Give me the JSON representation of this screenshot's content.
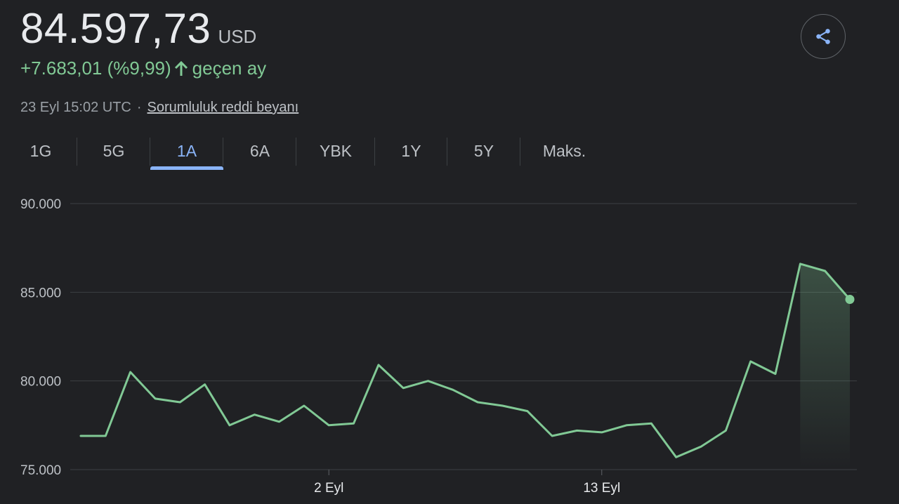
{
  "header": {
    "price": "84.597,73",
    "currency": "USD",
    "change": "+7.683,01 (%9,99)",
    "change_period": "geçen ay",
    "timestamp": "23 Eyl 15:02 UTC",
    "separator": "·",
    "disclaimer": "Sorumluluk reddi beyanı",
    "up_color": "#81c995"
  },
  "share": {
    "icon": "share-icon"
  },
  "tabs": [
    {
      "label": "1G",
      "active": false
    },
    {
      "label": "5G",
      "active": false
    },
    {
      "label": "1A",
      "active": true
    },
    {
      "label": "6A",
      "active": false
    },
    {
      "label": "YBK",
      "active": false
    },
    {
      "label": "1Y",
      "active": false
    },
    {
      "label": "5Y",
      "active": false
    },
    {
      "label": "Maks.",
      "active": false
    }
  ],
  "chart_data": {
    "type": "area",
    "title": "",
    "xlabel": "",
    "ylabel": "",
    "ylim": [
      75000,
      90000
    ],
    "y_ticks": [
      90000,
      85000,
      80000,
      75000
    ],
    "y_tick_labels": [
      "90.000",
      "85.000",
      "80.000",
      "75.000"
    ],
    "x_tick_labels": [
      {
        "label": "2 Eyl",
        "date": "2024-09-02"
      },
      {
        "label": "13 Eyl",
        "date": "2024-09-13"
      }
    ],
    "grid": true,
    "line_color": "#81c995",
    "series": [
      {
        "x": [
          "2024-08-23",
          "2024-08-24",
          "2024-08-25",
          "2024-08-26",
          "2024-08-27",
          "2024-08-28",
          "2024-08-29",
          "2024-08-30",
          "2024-08-31",
          "2024-09-01",
          "2024-09-02",
          "2024-09-03",
          "2024-09-04",
          "2024-09-05",
          "2024-09-06",
          "2024-09-07",
          "2024-09-08",
          "2024-09-09",
          "2024-09-10",
          "2024-09-11",
          "2024-09-12",
          "2024-09-13",
          "2024-09-14",
          "2024-09-15",
          "2024-09-16",
          "2024-09-17",
          "2024-09-18",
          "2024-09-19",
          "2024-09-20",
          "2024-09-21",
          "2024-09-22",
          "2024-09-23"
        ],
        "values": [
          76900,
          76900,
          80500,
          79000,
          78800,
          79800,
          77500,
          78100,
          77700,
          78600,
          77500,
          77600,
          80900,
          79600,
          80000,
          79500,
          78800,
          78600,
          78300,
          76900,
          77200,
          77100,
          77500,
          77600,
          75700,
          76300,
          77200,
          81100,
          80400,
          86600,
          86200,
          84597.73
        ]
      }
    ]
  }
}
